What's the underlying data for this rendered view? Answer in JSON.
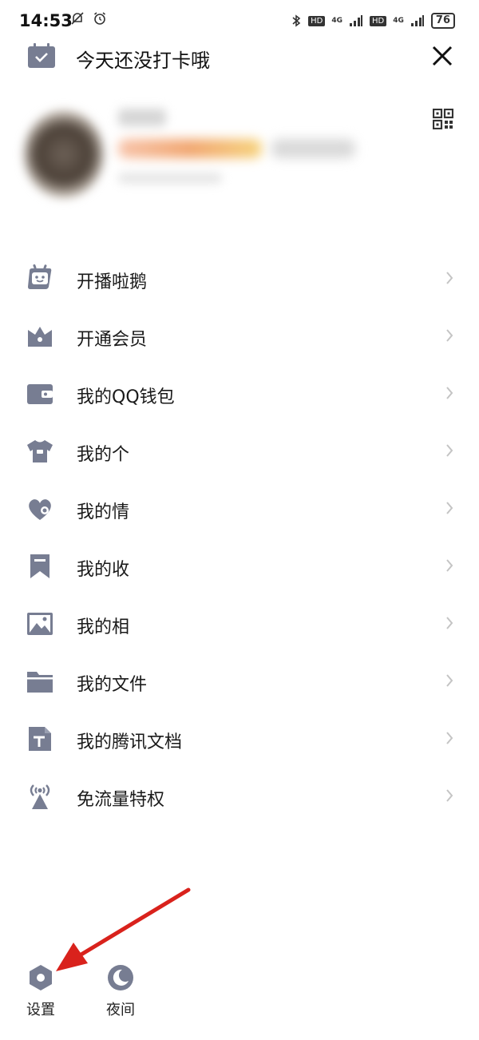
{
  "status_bar": {
    "time": "14:53",
    "network_1": "4G",
    "network_2": "4G",
    "hd_1": "HD",
    "hd_2": "HD",
    "battery": "76"
  },
  "checkin": {
    "text": "今天还没打卡哦"
  },
  "menu": {
    "items": [
      {
        "label": "开播啦鹅",
        "icon": "tv-robot-icon"
      },
      {
        "label": "开通会员",
        "icon": "crown-icon"
      },
      {
        "label": "我的QQ钱包",
        "icon": "wallet-icon"
      },
      {
        "label": "我的个",
        "icon": "shirt-icon"
      },
      {
        "label": "我的情",
        "icon": "heart-icon"
      },
      {
        "label": "我的收",
        "icon": "bookmark-icon"
      },
      {
        "label": "我的相",
        "icon": "photo-icon"
      },
      {
        "label": "我的文件",
        "icon": "folder-icon"
      },
      {
        "label": "我的腾讯文档",
        "icon": "document-icon"
      },
      {
        "label": "免流量特权",
        "icon": "signal-tower-icon"
      }
    ]
  },
  "bottom": {
    "settings_label": "设置",
    "night_label": "夜间"
  },
  "colors": {
    "icon_gray": "#777d92",
    "text": "#1a1a1a",
    "arrow_red": "#d9221c",
    "chevron": "#c4c4c4"
  }
}
